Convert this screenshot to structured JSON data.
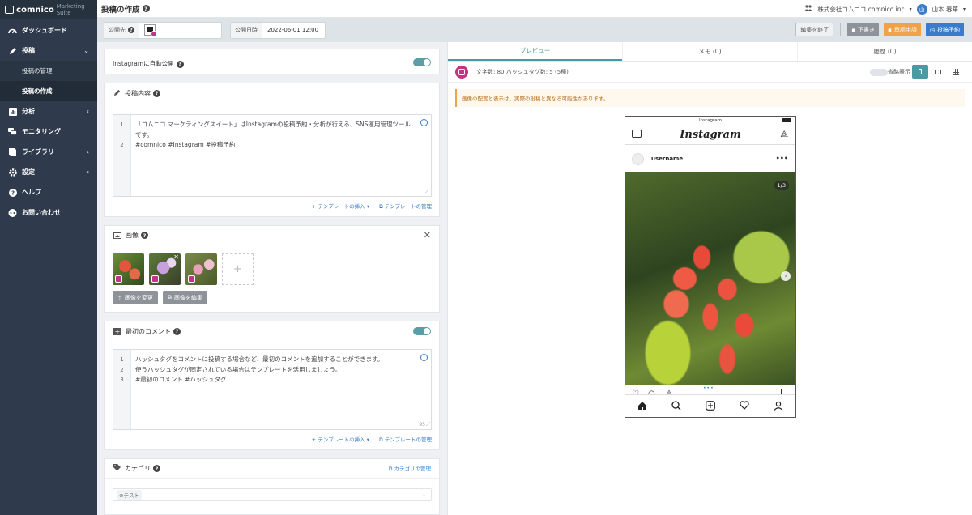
{
  "app": {
    "brand": "comnico",
    "suite": "Marketing Suite"
  },
  "sidebar": {
    "items": [
      {
        "label": "ダッシュボード",
        "icon": "gauge-icon"
      },
      {
        "label": "投稿",
        "icon": "pencil-icon",
        "chevron": "⌄"
      },
      {
        "label": "分析",
        "icon": "chart-icon",
        "chevron": "‹"
      },
      {
        "label": "モニタリング",
        "icon": "chat-icon"
      },
      {
        "label": "ライブラリ",
        "icon": "book-icon",
        "chevron": "‹"
      },
      {
        "label": "設定",
        "icon": "gear-icon",
        "chevron": "‹"
      },
      {
        "label": "ヘルプ",
        "icon": "help-circle-icon"
      },
      {
        "label": "お問い合わせ",
        "icon": "contact-icon"
      }
    ],
    "sub_items": [
      {
        "label": "投稿の管理"
      },
      {
        "label": "投稿の作成"
      }
    ]
  },
  "header": {
    "title": "投稿の作成",
    "company": "株式会社コムニコ comnico.inc",
    "user": "山本 春華",
    "user_initial": "山"
  },
  "toolbar": {
    "destination_label": "公開先",
    "date_label": "公開日時",
    "date_value": "2022-06-01 12:00",
    "end_edit": "編集を終了",
    "draft": "下書き",
    "approval": "承認申請",
    "schedule": "投稿予約"
  },
  "auto_publish": {
    "label": "Instagramに自動公開"
  },
  "content": {
    "title": "投稿内容",
    "lines": [
      "1",
      "2"
    ],
    "text_line1a": "「コムニコ マーケティングスイート」はInstagramの投稿予約・分析が行える、SNS運用管理ツール",
    "text_line1b": "です。",
    "text_line2": "#comnico #Instagram #投稿予約",
    "template_insert": "テンプレートの挿入",
    "template_manage": "テンプレートの管理"
  },
  "images": {
    "title": "画像",
    "change": "画像を変更",
    "edit": "画像を編集"
  },
  "comment": {
    "title": "最初のコメント",
    "lines": [
      "1",
      "2",
      "3"
    ],
    "text": [
      "ハッシュタグをコメントに投稿する場合など、最初のコメントを追加することができます。",
      "使うハッシュタグが固定されている場合はテンプレートを活用しましょう。",
      "#最初のコメント #ハッシュタグ"
    ],
    "counter": "95",
    "template_insert": "テンプレートの挿入",
    "template_manage": "テンプレートの管理"
  },
  "category": {
    "title": "カテゴリ",
    "manage": "カテゴリの管理",
    "tag": "テスト"
  },
  "preview": {
    "tabs": [
      "プレビュー",
      "メモ (0)",
      "履歴 (0)"
    ],
    "stats": "文字数: 80  ハッシュタグ数: 5 (5種)",
    "omit_label": "省略表示",
    "warning": "画像の配置と表示は、実際の投稿と異なる可能性があります。",
    "phone_top": "Instagram",
    "ig_logo": "Instagram",
    "username": "username",
    "counter": "1/3"
  },
  "colors": {
    "sidebar_bg": "#2f3b4c",
    "accent": "#4a9aa3",
    "draft": "#8e9399",
    "approval": "#f0a24a",
    "schedule": "#3a7cc9",
    "instagram": "#c13584"
  }
}
